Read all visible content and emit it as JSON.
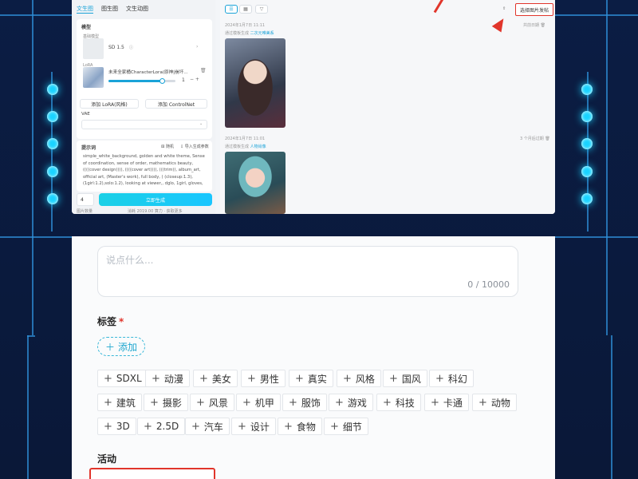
{
  "colors": {
    "accent": "#1aa3d8",
    "highlight": "#e1352b",
    "backdrop": "#0a1a3c",
    "glow": "#19d3ff"
  },
  "generator": {
    "tabs": [
      "文生图",
      "图生图",
      "文生动图"
    ],
    "model_section": "模型",
    "base_model_label": "基础模型",
    "base_model_value": "SD 1.5",
    "lora_label": "LoRA",
    "lora_name": "未来全家桶CharacterLora(原神|崩坏...",
    "lora_weight": "1",
    "add_lora_btn": "添加 LoRA(风格)",
    "add_controlnet_btn": "添加 ControlNet",
    "vae_label": "VAE",
    "prompt_label": "提示词",
    "random_label": "随机",
    "import_label": "导入生成参数",
    "prompt_lines": [
      "simple_white_background, golden and white theme, Sense",
      "of coordination, sense of order, mathematics beauty,",
      "((((cover design)))), ((((cover art)))), (((trim)), album_art,",
      "official art, (Master's work), full body, ( (closeup:1.3),",
      "(1girl:1.2),solo:1.2), looking at viewer,, dglo, 1girl, gloves,"
    ],
    "count_value": "4",
    "count_label": "图片数量",
    "generate_btn": "立即生成",
    "footer_note": "消耗 2019.00 算力 · 获取更多"
  },
  "results": {
    "publish_btn": "选择图片发帖",
    "group1": {
      "time": "2024年1月7日 11:11",
      "source": "通过模板生成",
      "link": "二次元唯美系"
    },
    "group2": {
      "time": "2024年1月7日 11:01",
      "source": "通过模板生成",
      "link": "人物肖像"
    },
    "right_note1": "共前日期",
    "right_note2": "3 个月后过期"
  },
  "form": {
    "textarea_placeholder": "说点什么...",
    "char_count": "0 / 10000",
    "tags_label": "标签",
    "required_mark": "*",
    "add_tag_label": "添加",
    "tag_rows": [
      [
        "SDXL",
        "动漫",
        "美女",
        "男性",
        "真实",
        "风格",
        "国风",
        "科幻"
      ],
      [
        "建筑",
        "摄影",
        "风景",
        "机甲",
        "服饰",
        "游戏",
        "科技",
        "卡通",
        "动物"
      ],
      [
        "3D",
        "2.5D",
        "汽车",
        "设计",
        "食物",
        "细节"
      ]
    ],
    "activity_label": "活动"
  }
}
